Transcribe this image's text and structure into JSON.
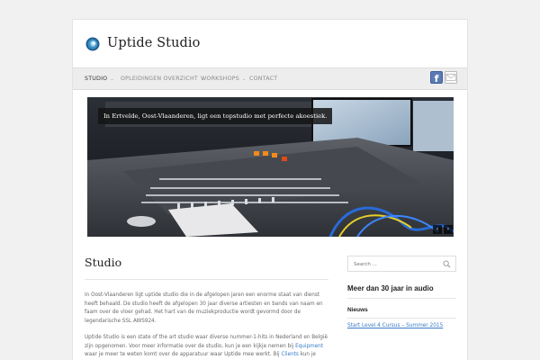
{
  "site": {
    "title": "Uptide Studio"
  },
  "nav": {
    "items": [
      {
        "label": "STUDIO",
        "has_dropdown": true,
        "active": true
      },
      {
        "label": "OPLEIDINGEN OVERZICHT",
        "has_dropdown": true,
        "active": false
      },
      {
        "label": "WORKSHOPS",
        "has_dropdown": true,
        "active": false
      },
      {
        "label": "CONTACT",
        "has_dropdown": false,
        "active": false
      }
    ],
    "chevron": "⌄"
  },
  "social": {
    "facebook_glyph": "f",
    "icons": [
      "facebook-icon",
      "mail-icon"
    ]
  },
  "slider": {
    "caption": "In Ertvelde, Oost-Vlaanderen, ligt een topstudio met perfecte akoestiek.",
    "prev": "‹",
    "next": "›"
  },
  "page": {
    "title": "Studio",
    "p1": "In Oost-Vlaanderen ligt uptide studio die in de afgelopen jaren een enorme staat van dienst heeft behaald. De studio heeft de afgelopen 30 jaar diverse artiesten en bands van naam en faam over de vloer gehad. Het hart van de muziekproductie wordt gevormd door de legendarische SSL AWS924.",
    "p2_a": "Uptide Studio is een state of the art studio waar diverse nummer-1-hits in Nederland en België zijn opgenomen. Voor meer informatie over de studio, kun je een kijkje nemen bij ",
    "p2_link1": "Equipment",
    "p2_b": " waar je meer te weten komt over de apparatuur waar Uptide mee werkt. Bij ",
    "p2_link2": "Clients",
    "p2_c": " kun je lezen"
  },
  "sidebar": {
    "search_placeholder": "Search ...",
    "widget1_title": "Meer dan 30 jaar in audio",
    "widget2_title": "Nieuws",
    "news_link": "Start Level 4 Cursus – Summer 2015"
  },
  "colors": {
    "link": "#3a7bc8",
    "nav_bg": "#ededed",
    "facebook": "#5a7ab5"
  }
}
